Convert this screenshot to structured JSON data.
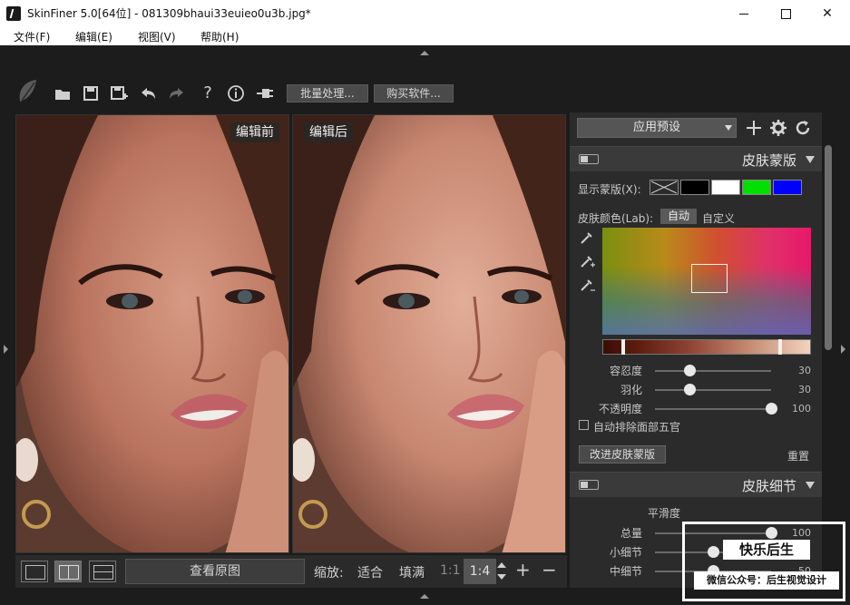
{
  "window": {
    "title": "SkinFiner 5.0[64位] - 081309bhaui33euieo0u3b.jpg*"
  },
  "menu": [
    "文件(F)",
    "编辑(E)",
    "视图(V)",
    "帮助(H)"
  ],
  "toolbar": {
    "icons": [
      "leaf-icon",
      "folder-open-icon",
      "save-icon",
      "save-as-icon",
      "undo-icon",
      "redo-icon",
      "help-icon",
      "info-icon",
      "plugin-icon"
    ],
    "batch_label": "批量处理...",
    "buy_label": "购买软件..."
  },
  "panes": {
    "before_label": "编辑前",
    "after_label": "编辑后"
  },
  "bottom": {
    "view_original": "查看原图",
    "zoom_label": "缩放:",
    "fit": "适合",
    "fill": "填满",
    "one_to_one": "1:1",
    "zoom_value": "1:4",
    "zoom_in": "+",
    "zoom_out": "−"
  },
  "panel": {
    "preset_label": "应用预设",
    "skin_mask": {
      "title": "皮肤蒙版",
      "show_mask_label": "显示蒙版(X):",
      "swatch_colors": [
        "#000000",
        "#ffffff",
        "#00e000",
        "#0000ff"
      ],
      "skin_color_label": "皮肤颜色(Lab):",
      "mode_auto": "自动",
      "mode_custom": "自定义",
      "sliders": [
        {
          "label": "容忍度",
          "value": "30",
          "fraction": 0.3
        },
        {
          "label": "羽化",
          "value": "30",
          "fraction": 0.3
        },
        {
          "label": "不透明度",
          "value": "100",
          "fraction": 1.0
        }
      ],
      "auto_exclude_label": "自动排除面部五官",
      "improve_button": "改进皮肤蒙版",
      "reset": "重置"
    },
    "skin_detail": {
      "title": "皮肤细节",
      "smoothness_label": "平滑度",
      "sliders": [
        {
          "label": "总量",
          "value": "100",
          "fraction": 1.0
        },
        {
          "label": "小细节",
          "value": "",
          "fraction": 0.5
        },
        {
          "label": "中细节",
          "value": "50",
          "fraction": 0.5
        }
      ]
    }
  },
  "watermark": {
    "line1": "快乐后生",
    "line2": "微信公众号：后生视觉设计"
  }
}
